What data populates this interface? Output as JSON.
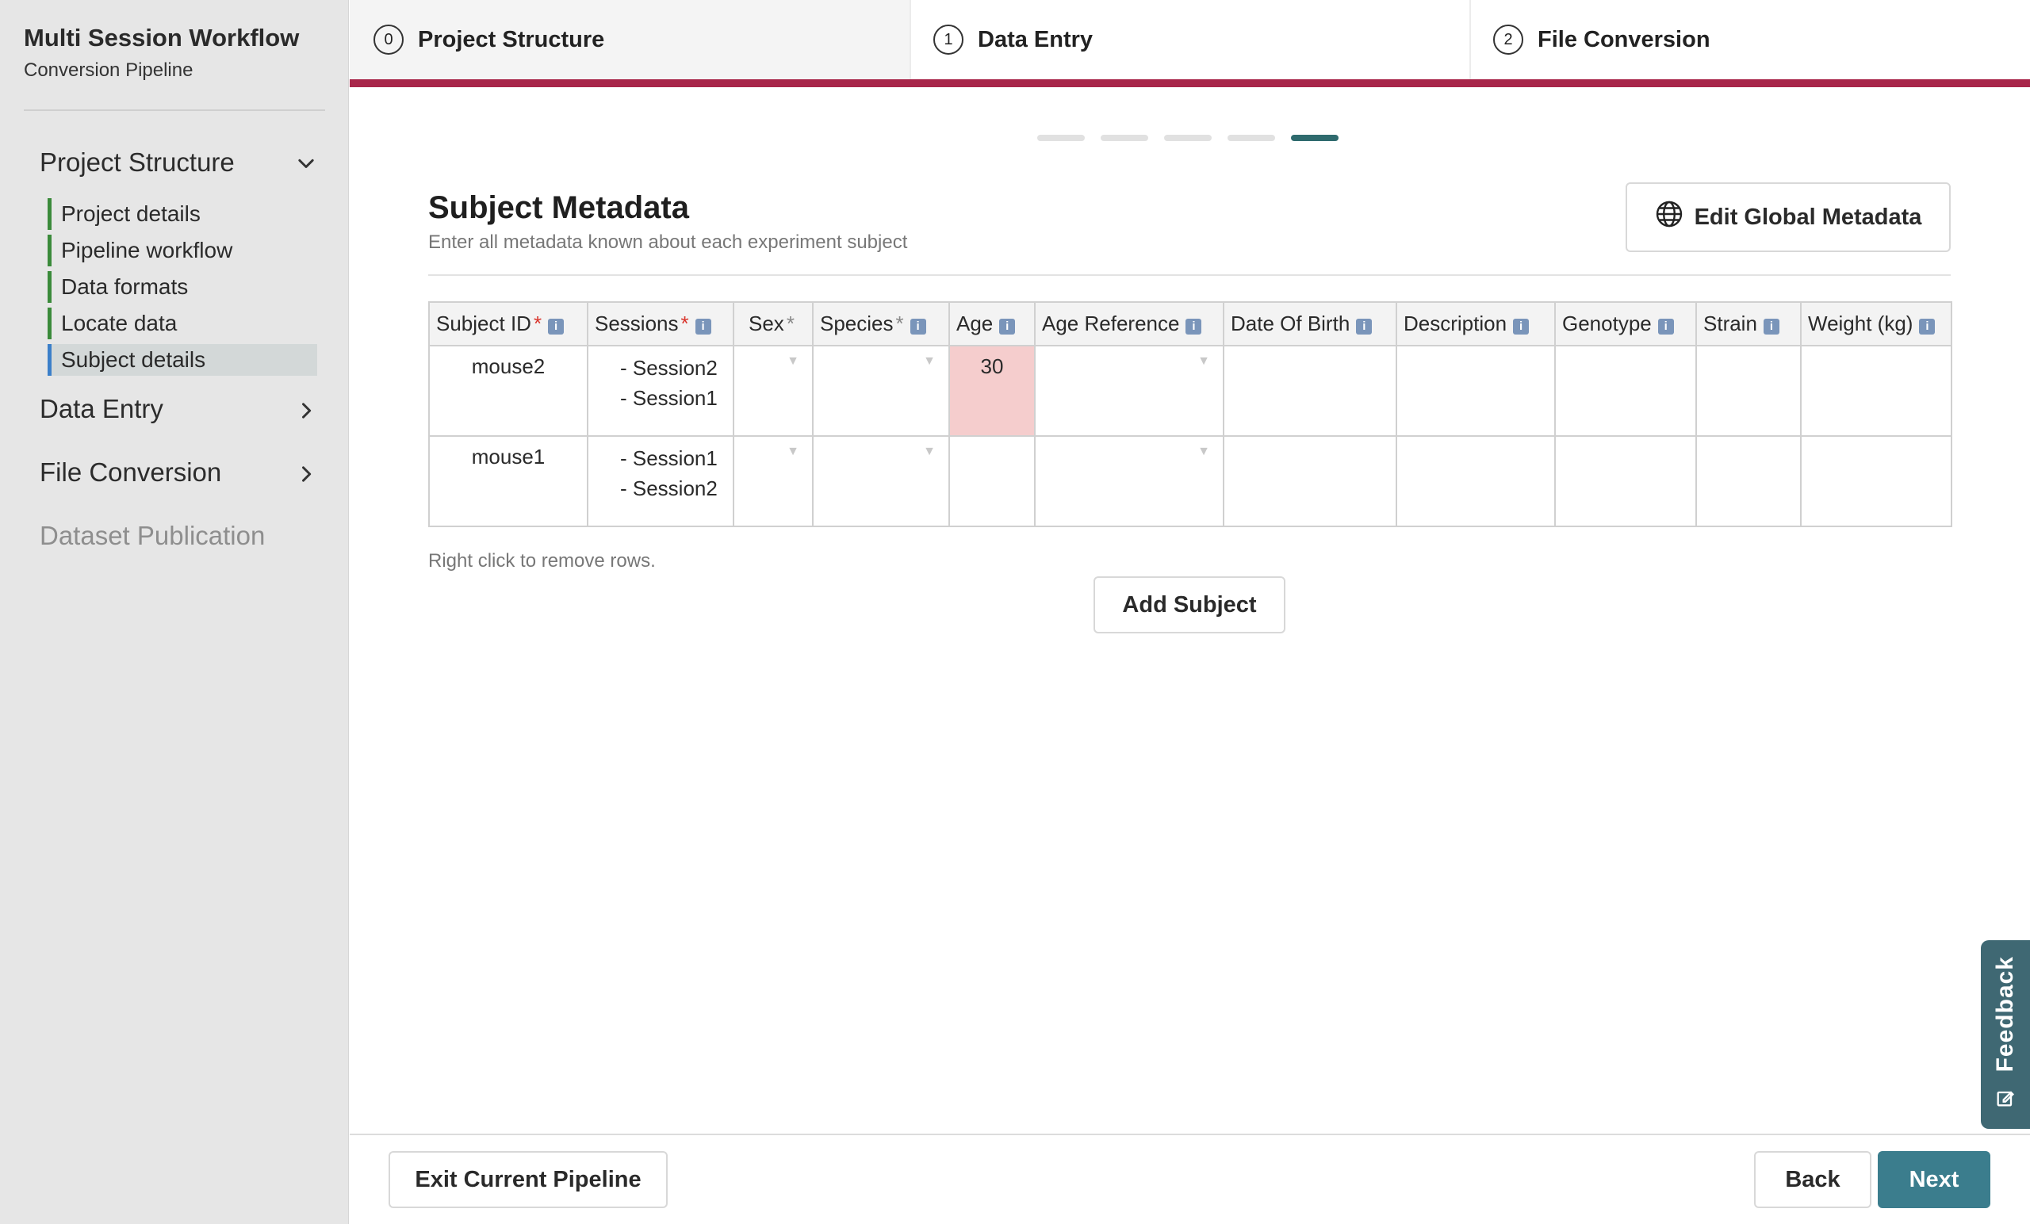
{
  "sidebar": {
    "title": "Multi Session Workflow",
    "subtitle": "Conversion Pipeline",
    "sections": [
      {
        "label": "Project Structure",
        "chevron": "chevron-down-icon"
      },
      {
        "label": "Data Entry",
        "chevron": "chevron-right-icon"
      },
      {
        "label": "File Conversion",
        "chevron": "chevron-right-icon"
      },
      {
        "label": "Dataset Publication"
      }
    ],
    "subitems": [
      "Project details",
      "Pipeline workflow",
      "Data formats",
      "Locate data",
      "Subject details"
    ],
    "active_subitem": "Subject details"
  },
  "stepper": {
    "steps": [
      {
        "num": "0",
        "label": "Project Structure"
      },
      {
        "num": "1",
        "label": "Data Entry"
      },
      {
        "num": "2",
        "label": "File Conversion"
      }
    ],
    "accent": "#a8264a"
  },
  "progress": {
    "total": 5,
    "current": 5
  },
  "header": {
    "title": "Subject Metadata",
    "description": "Enter all metadata known about each experiment subject",
    "global_button": "Edit Global Metadata"
  },
  "table": {
    "columns": [
      {
        "label": "Subject ID",
        "required": "*",
        "info": "i"
      },
      {
        "label": "Sessions",
        "required": "*",
        "info": "i"
      },
      {
        "label": "Sex",
        "required": "*"
      },
      {
        "label": "Species",
        "required": "*",
        "info": "i"
      },
      {
        "label": "Age",
        "info": "i"
      },
      {
        "label": "Age Reference",
        "info": "i"
      },
      {
        "label": "Date Of Birth",
        "info": "i"
      },
      {
        "label": "Description",
        "info": "i"
      },
      {
        "label": "Genotype",
        "info": "i"
      },
      {
        "label": "Strain",
        "info": "i"
      },
      {
        "label": "Weight (kg)",
        "info": "i"
      }
    ],
    "rows": [
      {
        "subject_id": "mouse2",
        "sessions": [
          "- Session2",
          "- Session1"
        ],
        "age": "30"
      },
      {
        "subject_id": "mouse1",
        "sessions": [
          "- Session1",
          "- Session2"
        ],
        "age": ""
      }
    ],
    "dropdown_arrow": "▼",
    "error_color": "#f5cdcd"
  },
  "hint": "Right click to remove rows.",
  "add_button": "Add Subject",
  "footer": {
    "exit": "Exit Current Pipeline",
    "back": "Back",
    "next": "Next"
  },
  "feedback": "Feedback"
}
